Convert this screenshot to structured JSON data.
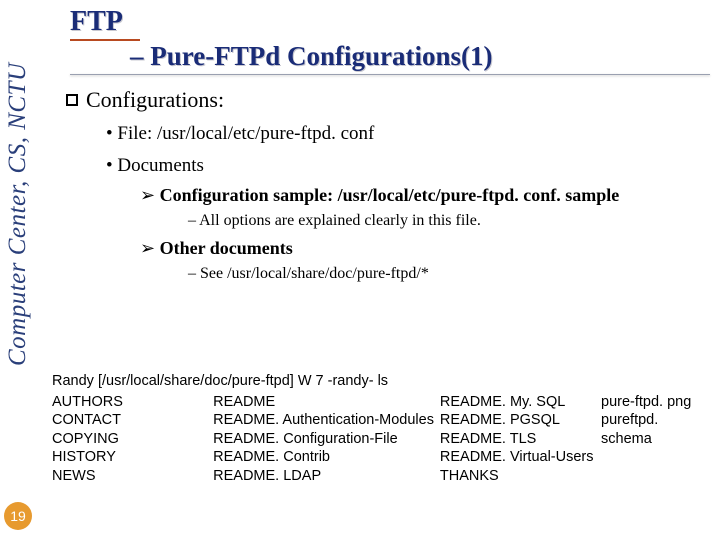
{
  "side_label": "Computer Center, CS, NCTU",
  "title": {
    "main": "FTP",
    "sub": "– Pure-FTPd Configurations(1)"
  },
  "body": {
    "config_heading": "Configurations:",
    "file_line": "File: /usr/local/etc/pure-ftpd. conf",
    "docs_line": "Documents",
    "sample_line": "Configuration sample: /usr/local/etc/pure-ftpd. conf. sample",
    "sample_note": "All options are explained clearly in this file.",
    "other_docs": "Other documents",
    "other_docs_note": "See /usr/local/share/doc/pure-ftpd/*"
  },
  "listing": {
    "prompt": "Randy [/usr/local/share/doc/pure-ftpd] W 7 -randy- ls",
    "col1": [
      "AUTHORS",
      "CONTACT",
      "COPYING",
      "HISTORY",
      "NEWS"
    ],
    "col2": [
      "README",
      "README. Authentication-Modules",
      "README. Configuration-File",
      "README. Contrib",
      "README. LDAP"
    ],
    "col3": [
      "README. My. SQL",
      "README. PGSQL",
      "README. TLS",
      "README. Virtual-Users",
      "THANKS"
    ],
    "col4": [
      "pure-ftpd. png",
      "pureftpd. schema"
    ]
  },
  "page_number": "19"
}
